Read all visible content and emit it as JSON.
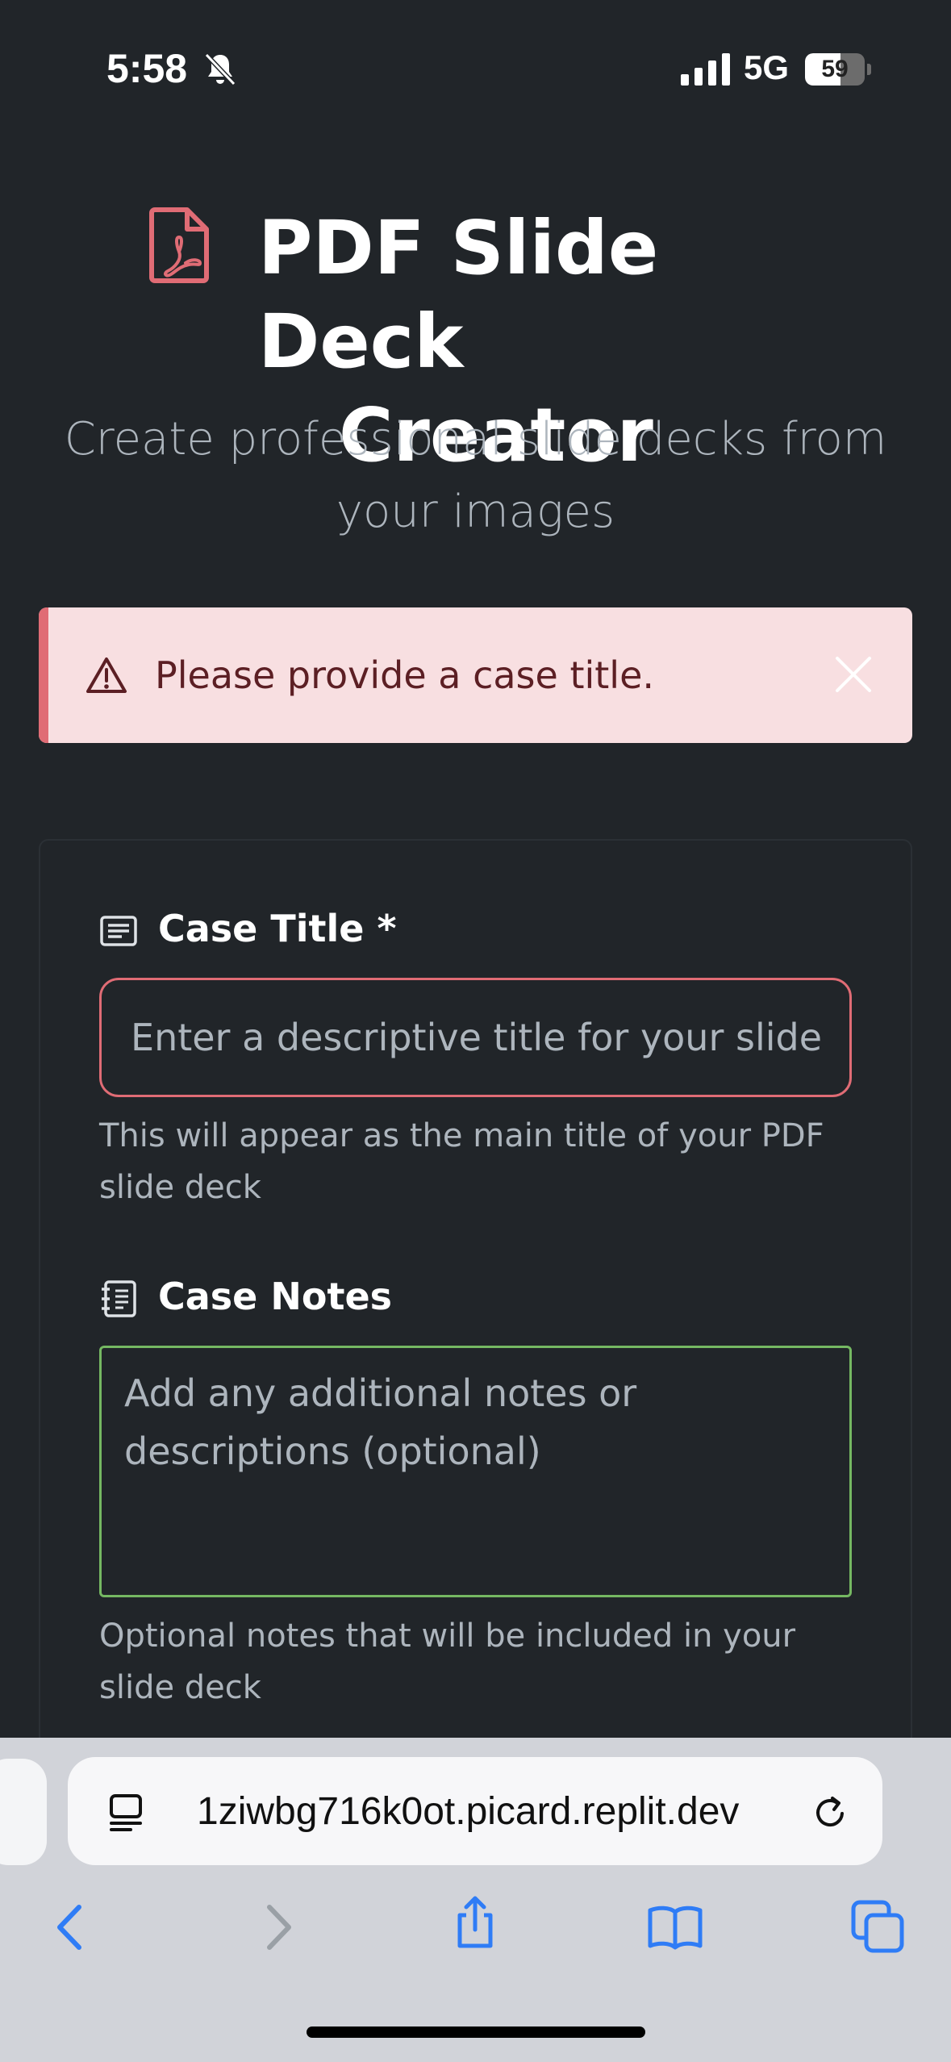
{
  "status_bar": {
    "time": "5:58",
    "network": "5G",
    "battery_level": "59"
  },
  "header": {
    "title_line1": "PDF Slide Deck",
    "title_line2": "Creator",
    "subtitle": "Create professional slide decks from your images"
  },
  "alert": {
    "message": "Please provide a case title.",
    "icon": "warning-triangle-icon"
  },
  "form": {
    "case_title": {
      "label": "Case Title *",
      "placeholder": "Enter a descriptive title for your slide deck",
      "value": "",
      "help": "This will appear as the main title of your PDF slide deck"
    },
    "case_notes": {
      "label": "Case Notes",
      "placeholder": "Add any additional notes or descriptions (optional)",
      "value": "",
      "help": "Optional notes that will be included in your slide deck"
    }
  },
  "browser": {
    "url": "1ziwbg716k0ot.picard.replit.dev"
  },
  "colors": {
    "background": "#212529",
    "error": "#e06c75",
    "success": "#75b862",
    "alert_bg": "#f8dfe1",
    "ios_blue": "#2f7cf6"
  }
}
